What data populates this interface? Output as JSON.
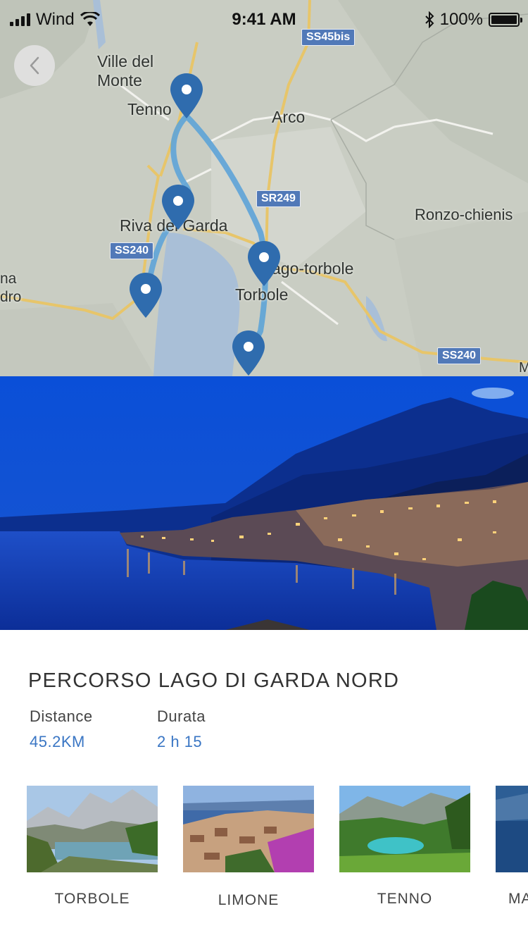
{
  "status_bar": {
    "carrier": "Wind",
    "time": "9:41 AM",
    "battery": "100%",
    "icons": [
      "signal-icon",
      "wifi-icon",
      "bluetooth-icon",
      "battery-icon"
    ]
  },
  "map": {
    "labels": {
      "ville": "Ville del\nMonte",
      "tenno": "Tenno",
      "arco": "Arco",
      "riva": "Riva del Garda",
      "ronzo": "Ronzo-chienis",
      "nago": "ago-torbole",
      "torbole": "Torbole",
      "na": "na",
      "dro": "dro",
      "m": "M"
    },
    "shields": {
      "ss45bis": "SS45bis",
      "sr249": "SR249",
      "ss240_left": "SS240",
      "ss240_right": "SS240"
    },
    "colors": {
      "route": "#5ea4d8",
      "pin": "#2f6cae",
      "water": "#a9bfd7"
    }
  },
  "route": {
    "title": "PERCORSO LAGO DI GARDA NORD",
    "distance_label": "Distance",
    "distance_value": "45.2KM",
    "duration_label": "Durata",
    "duration_value": "2 h 15"
  },
  "places": [
    {
      "name": "TORBOLE"
    },
    {
      "name": "LIMONE"
    },
    {
      "name": "TENNO"
    },
    {
      "name": "MA"
    }
  ],
  "colors": {
    "accent": "#3a76c4"
  }
}
